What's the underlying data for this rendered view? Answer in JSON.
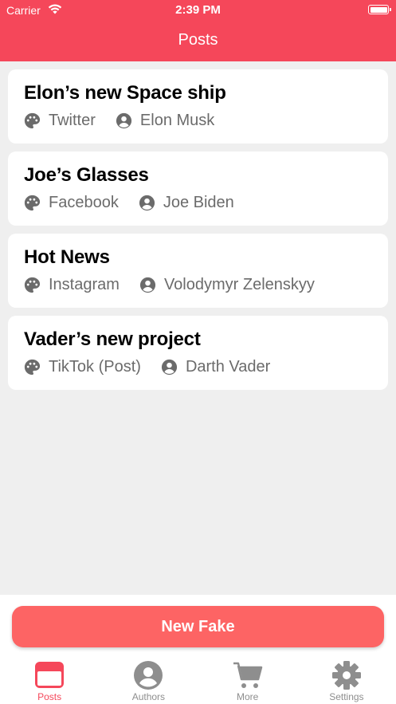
{
  "status_bar": {
    "carrier": "Carrier",
    "time": "2:39 PM"
  },
  "nav": {
    "title": "Posts"
  },
  "posts": [
    {
      "title": "Elon’s new Space ship",
      "platform": "Twitter",
      "author": "Elon Musk"
    },
    {
      "title": "Joe’s Glasses",
      "platform": "Facebook",
      "author": "Joe Biden"
    },
    {
      "title": "Hot News",
      "platform": "Instagram",
      "author": "Volodymyr Zelenskyy"
    },
    {
      "title": "Vader’s new project",
      "platform": "TikTok (Post)",
      "author": "Darth Vader"
    }
  ],
  "actions": {
    "new_button": "New Fake"
  },
  "tabs": [
    {
      "label": "Posts",
      "icon": "posts-icon",
      "active": true
    },
    {
      "label": "Authors",
      "icon": "user-circle-icon",
      "active": false
    },
    {
      "label": "More",
      "icon": "cart-icon",
      "active": false
    },
    {
      "label": "Settings",
      "icon": "gear-icon",
      "active": false
    }
  ],
  "colors": {
    "accent": "#f5475a",
    "button": "#fd6464",
    "background": "#efefef",
    "meta_text": "#6b6b6b",
    "tab_inactive": "#8e8e8e"
  }
}
